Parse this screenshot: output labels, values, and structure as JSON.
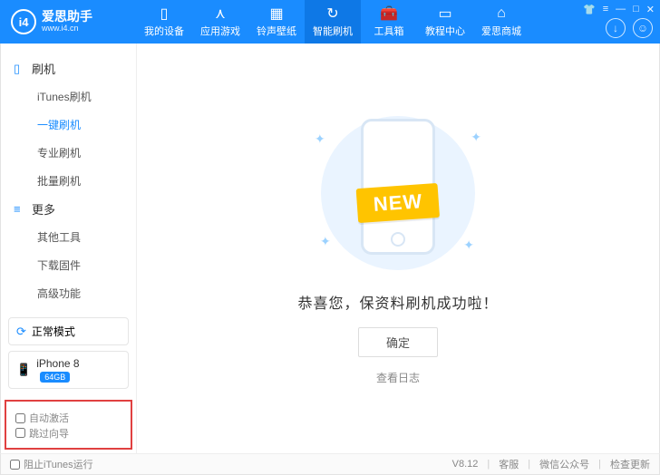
{
  "app": {
    "logoMono": "i4",
    "title": "爱思助手",
    "url": "www.i4.cn"
  },
  "nav": {
    "device": "我的设备",
    "apps": "应用游戏",
    "ringtone": "铃声壁纸",
    "flash": "智能刷机",
    "toolbox": "工具箱",
    "tutorial": "教程中心",
    "store": "爱思商城"
  },
  "sidebar": {
    "group1": {
      "title": "刷机",
      "items": [
        "iTunes刷机",
        "一键刷机",
        "专业刷机",
        "批量刷机"
      ],
      "activeIndex": 1
    },
    "group2": {
      "title": "更多",
      "items": [
        "其他工具",
        "下载固件",
        "高级功能"
      ]
    },
    "mode": "正常模式",
    "device": {
      "name": "iPhone 8",
      "storage": "64GB"
    },
    "checks": {
      "autoActivate": "自动激活",
      "skipGuide": "跳过向导"
    }
  },
  "main": {
    "ribbon": "NEW",
    "success": "恭喜您，保资料刷机成功啦！",
    "ok": "确定",
    "viewLog": "查看日志"
  },
  "footer": {
    "blockItunes": "阻止iTunes运行",
    "version": "V8.12",
    "support": "客服",
    "wechat": "微信公众号",
    "update": "检查更新"
  }
}
